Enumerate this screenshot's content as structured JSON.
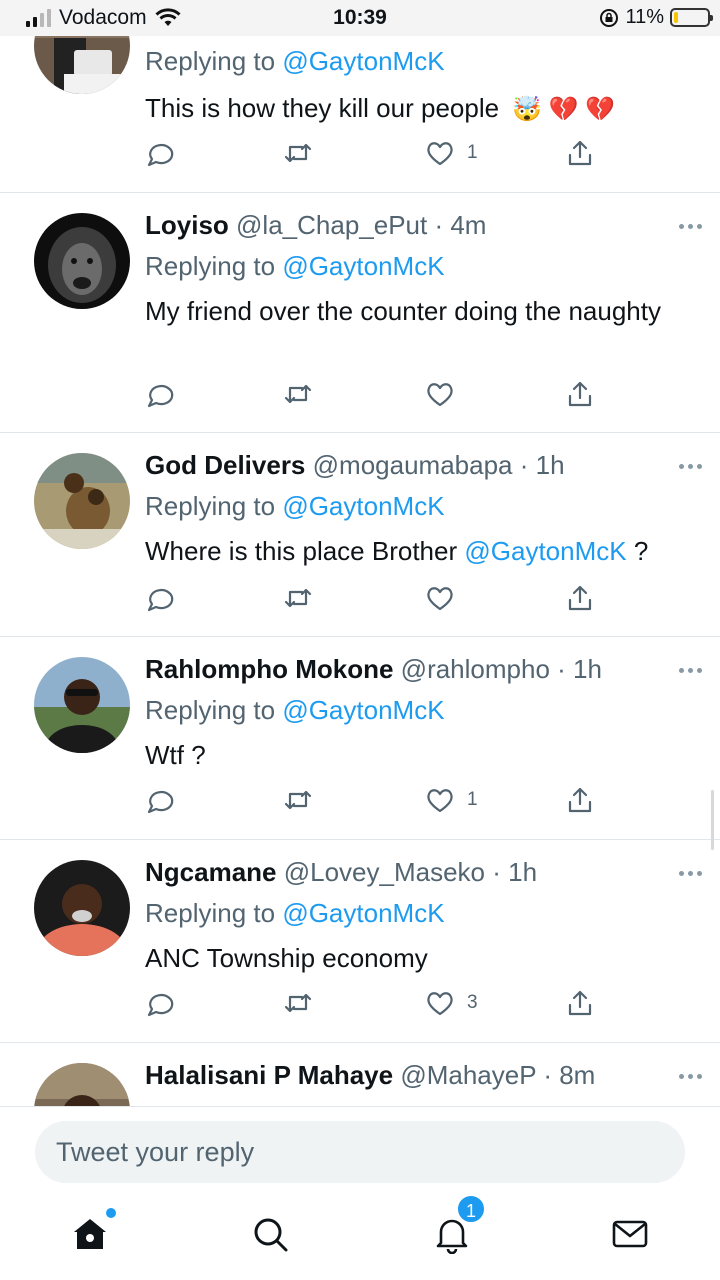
{
  "status_bar": {
    "carrier": "Vodacom",
    "time": "10:39",
    "battery": "11%",
    "battery_level": 0.11
  },
  "tweets": [
    {
      "replying_prefix": "Replying to",
      "replying_to": "@GaytonMcK",
      "text": "This is how they kill our people",
      "emoji": "🤯 💔 💔",
      "like_count": "1"
    },
    {
      "name": "Loyiso",
      "handle": "@la_Chap_ePut",
      "time": "4m",
      "replying_prefix": "Replying to",
      "replying_to": "@GaytonMcK",
      "text": "My friend over the counter doing the naughty",
      "like_count": ""
    },
    {
      "name": "God Delivers",
      "handle": "@mogaumabapa",
      "time": "1h",
      "replying_prefix": "Replying to",
      "replying_to": "@GaytonMcK",
      "text": "Where is this place Brother",
      "mention": "@GaytonMcK",
      "text_suffix": "?",
      "like_count": ""
    },
    {
      "name": "Rahlompho Mokone",
      "handle": "@rahlompho",
      "time": "1h",
      "replying_prefix": "Replying to",
      "replying_to": "@GaytonMcK",
      "text": "Wtf ?",
      "like_count": "1"
    },
    {
      "name": "Ngcamane",
      "handle": "@Lovey_Maseko",
      "time": "1h",
      "replying_prefix": "Replying to",
      "replying_to": "@GaytonMcK",
      "text": "ANC Township economy",
      "like_count": "3"
    },
    {
      "name": "Halalisani P Mahaye",
      "handle": "@MahayeP",
      "time": "8m"
    }
  ],
  "reply": {
    "placeholder": "Tweet your reply"
  },
  "tabs": {
    "notifications_badge": "1"
  },
  "colors": {
    "accent": "#1d9bf0",
    "text": "#0f1419",
    "muted": "#536471",
    "divider": "#e1e6ea"
  }
}
